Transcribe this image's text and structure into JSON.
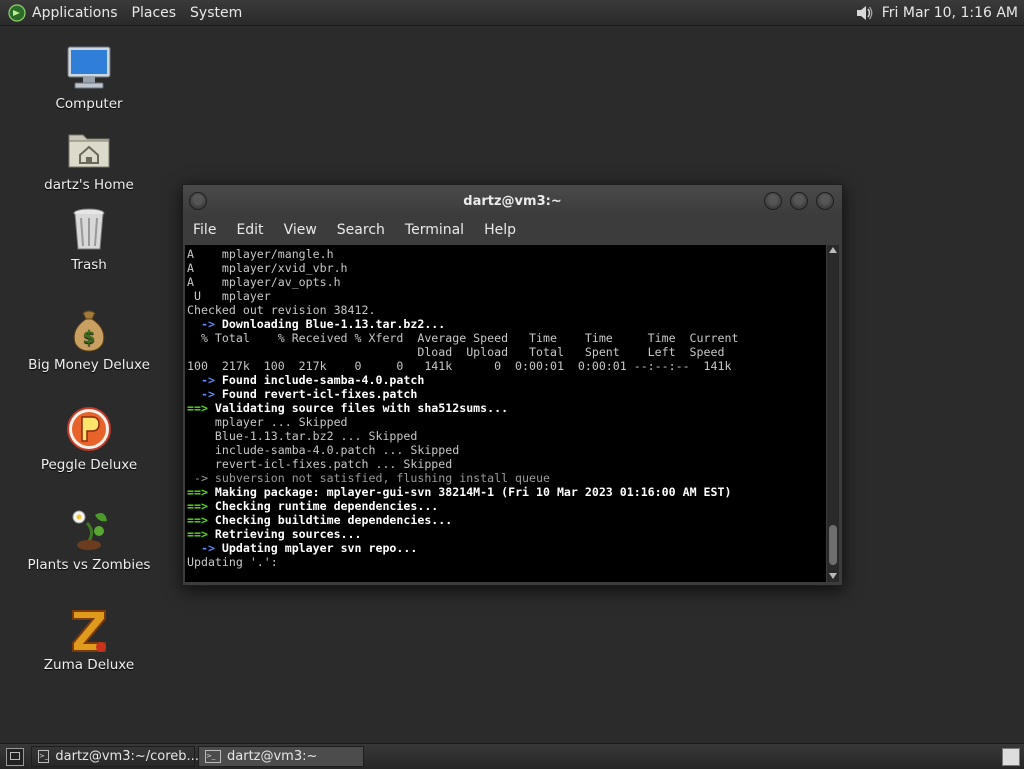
{
  "top_panel": {
    "menus": [
      "Applications",
      "Places",
      "System"
    ],
    "clock": "Fri Mar 10,  1:16 AM"
  },
  "desktop_icons": [
    {
      "label": "Computer",
      "icon": "computer-icon"
    },
    {
      "label": "dartz's Home",
      "icon": "home-folder-icon"
    },
    {
      "label": "Trash",
      "icon": "trash-icon"
    },
    {
      "label": "Big Money Deluxe",
      "icon": "money-bag-icon"
    },
    {
      "label": "Peggle Deluxe",
      "icon": "peggle-icon"
    },
    {
      "label": "Plants vs Zombies",
      "icon": "plants-icon"
    },
    {
      "label": "Zuma Deluxe",
      "icon": "zuma-icon"
    }
  ],
  "terminal": {
    "title": "dartz@vm3:~",
    "menu": [
      "File",
      "Edit",
      "View",
      "Search",
      "Terminal",
      "Help"
    ],
    "lines": [
      {
        "style": "",
        "text": "A    mplayer/mangle.h"
      },
      {
        "style": "",
        "text": "A    mplayer/xvid_vbr.h"
      },
      {
        "style": "",
        "text": "A    mplayer/av_opts.h"
      },
      {
        "style": "",
        "text": " U   mplayer"
      },
      {
        "style": "",
        "text": "Checked out revision 38412."
      },
      {
        "style": "arrow",
        "prefix": "  -> ",
        "text": "Downloading Blue-1.13.tar.bz2..."
      },
      {
        "style": "",
        "text": "  % Total    % Received % Xferd  Average Speed   Time    Time     Time  Current"
      },
      {
        "style": "",
        "text": "                                 Dload  Upload   Total   Spent    Left  Speed"
      },
      {
        "style": "",
        "text": "100  217k  100  217k    0     0   141k      0  0:00:01  0:00:01 --:--:--  141k"
      },
      {
        "style": "arrow",
        "prefix": "  -> ",
        "text": "Found include-samba-4.0.patch"
      },
      {
        "style": "arrow",
        "prefix": "  -> ",
        "text": "Found revert-icl-fixes.patch"
      },
      {
        "style": "green",
        "prefix": "==> ",
        "text": "Validating source files with sha512sums..."
      },
      {
        "style": "",
        "text": "    mplayer ... Skipped"
      },
      {
        "style": "",
        "text": "    Blue-1.13.tar.bz2 ... Skipped"
      },
      {
        "style": "",
        "text": "    include-samba-4.0.patch ... Skipped"
      },
      {
        "style": "",
        "text": "    revert-icl-fixes.patch ... Skipped"
      },
      {
        "style": "dim",
        "text": " -> subversion not satisfied, flushing install queue"
      },
      {
        "style": "green",
        "prefix": "==> ",
        "text": "Making package: mplayer-gui-svn 38214M-1 (Fri 10 Mar 2023 01:16:00 AM EST)"
      },
      {
        "style": "green",
        "prefix": "==> ",
        "text": "Checking runtime dependencies..."
      },
      {
        "style": "green",
        "prefix": "==> ",
        "text": "Checking buildtime dependencies..."
      },
      {
        "style": "green",
        "prefix": "==> ",
        "text": "Retrieving sources..."
      },
      {
        "style": "arrow",
        "prefix": "  -> ",
        "text": "Updating mplayer svn repo..."
      },
      {
        "style": "",
        "text": "Updating '.':"
      }
    ]
  },
  "taskbar": {
    "tasks": [
      {
        "label": "dartz@vm3:~/coreb...",
        "active": false
      },
      {
        "label": "dartz@vm3:~",
        "active": true
      }
    ]
  },
  "colors": {
    "prompt_green": "#58e01a",
    "desktop_bg": "#2b2b2b",
    "terminal_bg": "#000000"
  }
}
